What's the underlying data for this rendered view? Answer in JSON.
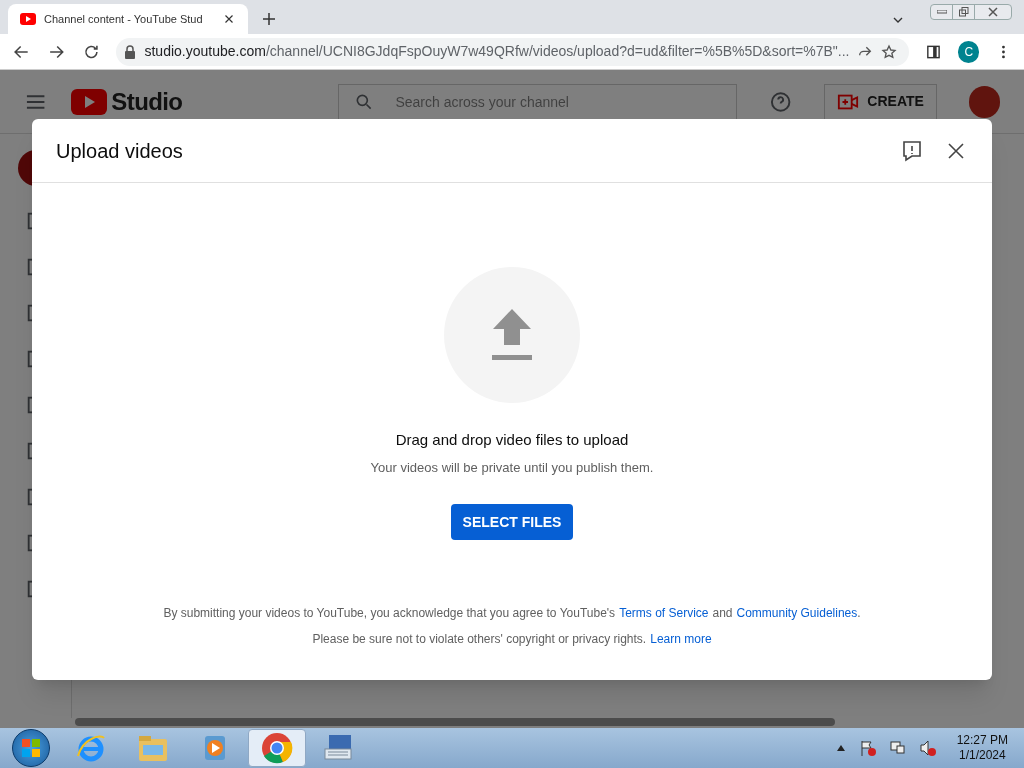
{
  "browser": {
    "tab": {
      "title": "Channel content - YouTube Stud"
    },
    "address": {
      "host": "studio.youtube.com",
      "path": "/channel/UCNI8GJdqFspOuyW7w49QRfw/videos/upload?d=ud&filter=%5B%5D&sort=%7B\"..."
    },
    "profile_initial": "C"
  },
  "studio": {
    "logo": "Studio",
    "search": {
      "placeholder": "Search across your channel"
    },
    "create": "CREATE"
  },
  "dialog": {
    "title": "Upload videos",
    "prompt": "Drag and drop video files to upload",
    "note": "Your videos will be private until you publish them.",
    "button": "SELECT FILES",
    "legal_1": {
      "before": "By submitting your videos to YouTube, you acknowledge that you agree to YouTube's",
      "link_1": "Terms of Service",
      "middle": "and",
      "link_2": "Community Guidelines",
      "end": "."
    },
    "legal_2": {
      "before": "Please be sure not to violate others' copyright or privacy rights.",
      "link": "Learn more"
    }
  },
  "taskbar": {
    "apps": [
      {
        "kind": "ie",
        "selected": false
      },
      {
        "kind": "explorer",
        "selected": false
      },
      {
        "kind": "media",
        "selected": false
      },
      {
        "kind": "chrome",
        "selected": true
      },
      {
        "kind": "keyboard",
        "selected": false
      }
    ],
    "time": "12:27 PM",
    "date": "1/1/2024"
  }
}
